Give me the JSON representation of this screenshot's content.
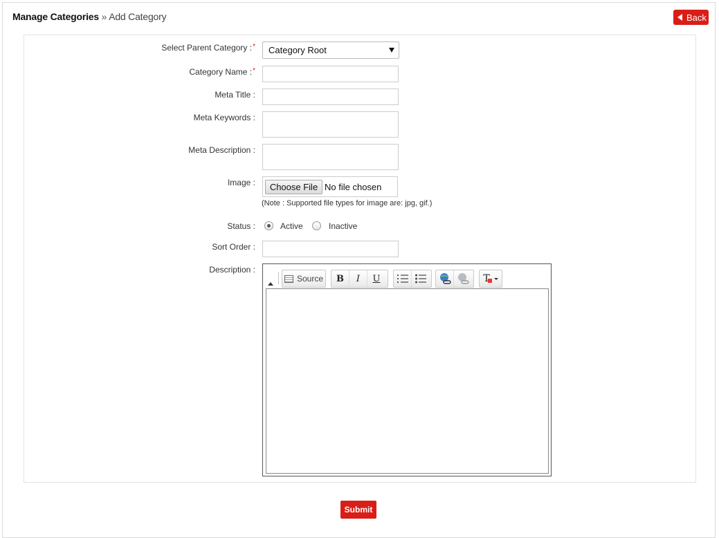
{
  "breadcrumb": {
    "root": "Manage Categories",
    "separator": " » ",
    "current": "Add Category"
  },
  "header": {
    "back_label": "Back"
  },
  "form": {
    "parent_category": {
      "label": "Select Parent Category :",
      "required": "*",
      "value": "Category Root"
    },
    "category_name": {
      "label": "Category Name :",
      "required": "*",
      "value": ""
    },
    "meta_title": {
      "label": "Meta Title :",
      "value": ""
    },
    "meta_keywords": {
      "label": "Meta Keywords :",
      "value": ""
    },
    "meta_description": {
      "label": "Meta Description :",
      "value": ""
    },
    "image": {
      "label": "Image :",
      "button": "Choose File",
      "status": "No file chosen",
      "note": "(Note : Supported file types for image are: jpg, gif.)"
    },
    "status": {
      "label": "Status :",
      "options": [
        "Active",
        "Inactive"
      ],
      "selected": "Active"
    },
    "sort_order": {
      "label": "Sort Order :",
      "value": ""
    },
    "description": {
      "label": "Description :",
      "toolbar": {
        "source": "Source",
        "bold": "B",
        "italic": "I",
        "underline": "U",
        "text_color": "T"
      }
    }
  },
  "submit_label": "Submit",
  "colors": {
    "accent": "#d91e18",
    "border": "#cccccc"
  },
  "icons": [
    "back-arrow-icon",
    "source-icon",
    "bold-icon",
    "italic-icon",
    "underline-icon",
    "numbered-list-icon",
    "bulleted-list-icon",
    "link-icon",
    "unlink-icon",
    "text-color-icon",
    "dropdown-arrow-icon",
    "collapse-toolbar-icon"
  ]
}
